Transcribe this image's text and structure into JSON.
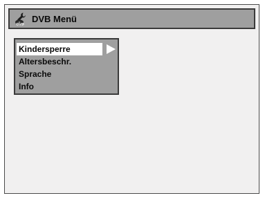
{
  "title_bar": {
    "icon": "dvd-settings-icon",
    "title": "DVB Menü"
  },
  "menu": {
    "selected_index": 0,
    "items": [
      {
        "label": "Kindersperre"
      },
      {
        "label": "Altersbeschr."
      },
      {
        "label": "Sprache"
      },
      {
        "label": "Info"
      }
    ],
    "submenu_indicator": "right-arrow-icon"
  },
  "colors": {
    "screen_bg": "#f1f0f0",
    "panel_bg": "#9f9f9f",
    "border": "#3a3a3a",
    "highlight": "#ffffff",
    "text": "#0a0a0a"
  }
}
